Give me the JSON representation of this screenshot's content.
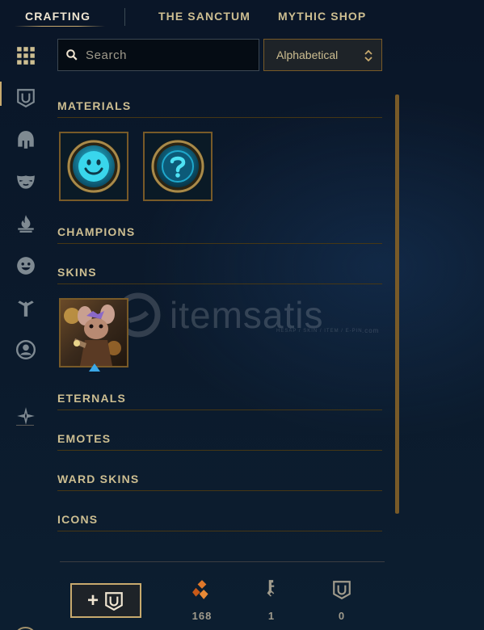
{
  "nav": {
    "tabs": [
      {
        "label": "CRAFTING",
        "active": true
      },
      {
        "label": "THE SANCTUM",
        "active": false
      },
      {
        "label": "MYTHIC SHOP",
        "active": false
      }
    ]
  },
  "sidebar": {
    "items": [
      {
        "icon": "grid-icon",
        "active": true
      },
      {
        "icon": "chest-icon"
      },
      {
        "icon": "champion-helmet-icon"
      },
      {
        "icon": "skin-mask-icon"
      },
      {
        "icon": "eternals-flame-icon"
      },
      {
        "icon": "emote-face-icon"
      },
      {
        "icon": "ward-icon"
      },
      {
        "icon": "profile-icon"
      },
      {
        "icon": "loot-filter-icon"
      }
    ],
    "help_label": "?"
  },
  "search": {
    "placeholder": "Search",
    "value": ""
  },
  "sort": {
    "selected": "Alphabetical"
  },
  "sections": [
    {
      "title": "MATERIALS",
      "items": [
        "emote-orb",
        "mystery-emote-orb"
      ]
    },
    {
      "title": "CHAMPIONS",
      "items": []
    },
    {
      "title": "SKINS",
      "items": [
        "skin-shard"
      ]
    },
    {
      "title": "ETERNALS",
      "items": []
    },
    {
      "title": "EMOTES",
      "items": []
    },
    {
      "title": "WARD SKINS",
      "items": []
    },
    {
      "title": "ICONS",
      "items": []
    }
  ],
  "watermark": {
    "text": "itemsatis",
    "subtext": "HESAP / SKIN / ITEM / E-PIN",
    "domain": ".com"
  },
  "footer": {
    "craft_button_label": "+",
    "currencies": [
      {
        "icon": "orange-essence-icon",
        "count": "168"
      },
      {
        "icon": "key-icon",
        "count": "1"
      },
      {
        "icon": "chest-icon",
        "count": "0"
      }
    ]
  },
  "colors": {
    "gold": "#c8aa6e",
    "gold_dark": "#785a28",
    "text": "#cdbe91",
    "background": "#0a1628",
    "orange_essence": "#e0782a",
    "orb_cyan": "#1fb8d8"
  }
}
